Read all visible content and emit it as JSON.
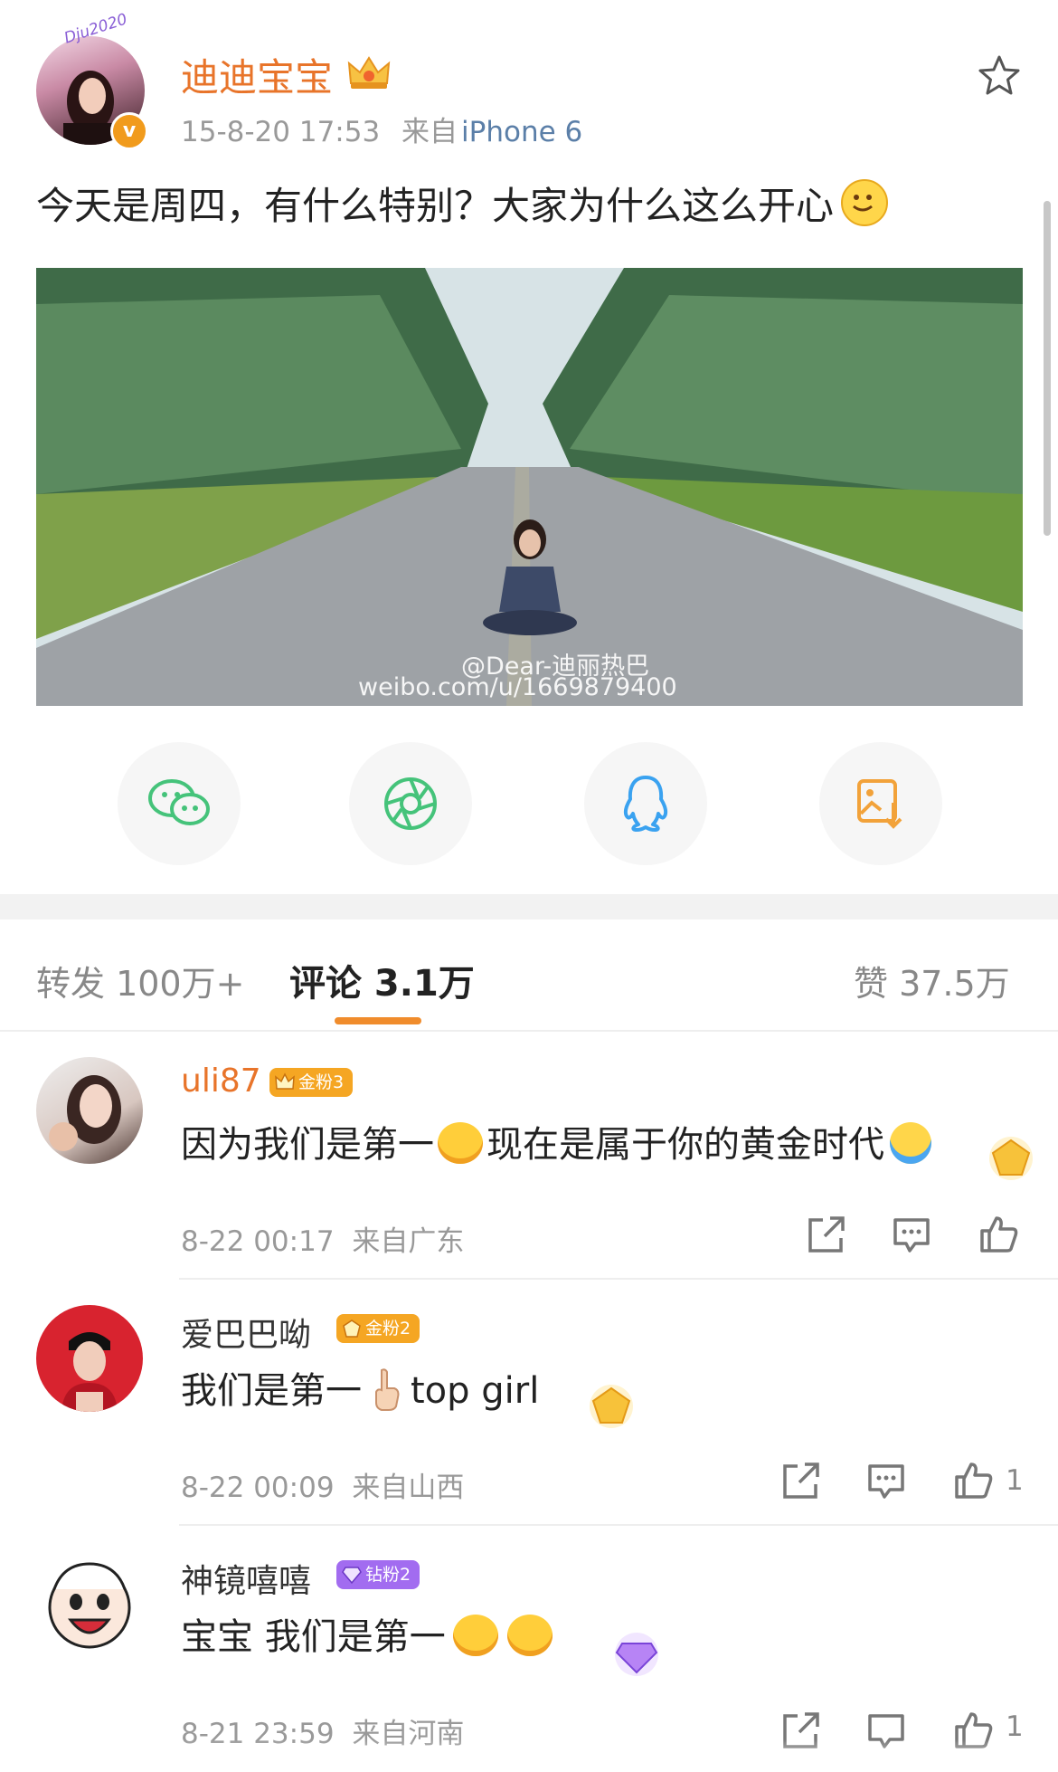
{
  "post": {
    "author": "迪迪宝宝",
    "time": "15-8-20 17:53",
    "source_prefix": "来自",
    "source_device": "iPhone 6",
    "text": "今天是周四，有什么特别？大家为什么这么开心",
    "avatar_watermark": "Dju2020",
    "image_watermark_handle": "@Dear-迪丽热巴",
    "image_watermark_url": "weibo.com/u/1669879400"
  },
  "share_icons": [
    "wechat-icon",
    "moments-icon",
    "qq-icon",
    "save-image-icon"
  ],
  "stats": {
    "reposts": "转发 100万+",
    "comments": "评论 3.1万",
    "likes": "赞 37.5万"
  },
  "comments": [
    {
      "name": "uli87",
      "badge": "金粉3",
      "text_a": "因为我们是第一",
      "text_b": "现在是属于你的黄金时代",
      "time": "8-22 00:17",
      "location": "来自广东",
      "like_count": ""
    },
    {
      "name": "爱巴巴呦",
      "badge": "金粉2",
      "text_a": "我们是第一",
      "text_b": "top girl",
      "time": "8-22 00:09",
      "location": "来自山西",
      "like_count": "1"
    },
    {
      "name": "神镜嘻嘻",
      "badge": "钻粉2",
      "text_a": "宝宝 我们是第一",
      "text_b": "",
      "time": "8-21 23:59",
      "location": "来自河南",
      "like_count": "1"
    }
  ],
  "colors": {
    "name_orange": "#e8742a",
    "link_blue": "#5b7fa8",
    "tab_underline": "#f08c2c",
    "gold_badge": "#f5a623",
    "diamond_badge": "#a26cf0",
    "wechat_green": "#45c37a",
    "moments_green": "#45c37a",
    "qq_blue": "#3aa2f0",
    "save_orange": "#f2a23a"
  }
}
